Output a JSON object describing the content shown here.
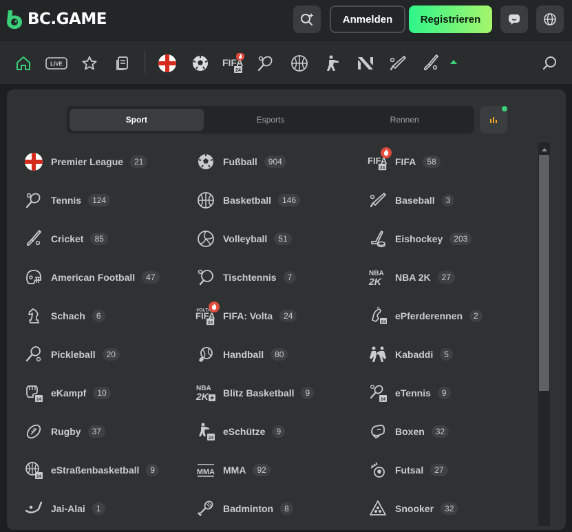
{
  "header": {
    "logo_text": "BC.GAME",
    "login_label": "Anmelden",
    "register_label": "Registrieren"
  },
  "nav": {
    "live_label": "LIVE",
    "fifa_label": "FIFA"
  },
  "tabs": [
    {
      "label": "Sport",
      "active": true
    },
    {
      "label": "Esports",
      "active": false
    },
    {
      "label": "Rennen",
      "active": false
    }
  ],
  "sports": [
    {
      "label": "Premier League",
      "count": "21",
      "icon": "england-flag-icon"
    },
    {
      "label": "Fußball",
      "count": "904",
      "icon": "soccer-ball-icon"
    },
    {
      "label": "FIFA",
      "count": "58",
      "icon": "fifa-icon",
      "hot": true
    },
    {
      "label": "Tennis",
      "count": "124",
      "icon": "tennis-icon"
    },
    {
      "label": "Basketball",
      "count": "146",
      "icon": "basketball-icon"
    },
    {
      "label": "Baseball",
      "count": "3",
      "icon": "baseball-icon"
    },
    {
      "label": "Cricket",
      "count": "85",
      "icon": "cricket-icon"
    },
    {
      "label": "Volleyball",
      "count": "51",
      "icon": "volleyball-icon"
    },
    {
      "label": "Eishockey",
      "count": "203",
      "icon": "ice-hockey-icon"
    },
    {
      "label": "American Football",
      "count": "47",
      "icon": "american-football-icon"
    },
    {
      "label": "Tischtennis",
      "count": "7",
      "icon": "table-tennis-icon"
    },
    {
      "label": "NBA 2K",
      "count": "27",
      "icon": "nba2k-icon"
    },
    {
      "label": "Schach",
      "count": "6",
      "icon": "chess-icon"
    },
    {
      "label": "FIFA: Volta",
      "count": "24",
      "icon": "fifa-volta-icon",
      "hot": true
    },
    {
      "label": "ePferderennen",
      "count": "2",
      "icon": "horse-racing-icon"
    },
    {
      "label": "Pickleball",
      "count": "20",
      "icon": "pickleball-icon"
    },
    {
      "label": "Handball",
      "count": "80",
      "icon": "handball-icon"
    },
    {
      "label": "Kabaddi",
      "count": "5",
      "icon": "kabaddi-icon"
    },
    {
      "label": "eKampf",
      "count": "10",
      "icon": "efight-icon"
    },
    {
      "label": "Blitz Basketball",
      "count": "9",
      "icon": "blitz-basketball-icon"
    },
    {
      "label": "eTennis",
      "count": "9",
      "icon": "etennis-icon"
    },
    {
      "label": "Rugby",
      "count": "37",
      "icon": "rugby-icon"
    },
    {
      "label": "eSchütze",
      "count": "9",
      "icon": "eshooter-icon"
    },
    {
      "label": "Boxen",
      "count": "32",
      "icon": "boxing-icon"
    },
    {
      "label": "eStraßenbasketball",
      "count": "9",
      "icon": "street-basketball-icon"
    },
    {
      "label": "MMA",
      "count": "92",
      "icon": "mma-icon"
    },
    {
      "label": "Futsal",
      "count": "27",
      "icon": "futsal-icon"
    },
    {
      "label": "Jai-Alai",
      "count": "1",
      "icon": "jai-alai-icon"
    },
    {
      "label": "Badminton",
      "count": "8",
      "icon": "badminton-icon"
    },
    {
      "label": "Snooker",
      "count": "32",
      "icon": "snooker-icon"
    }
  ],
  "colors": {
    "accent": "#3bd17a",
    "hot": "#e24a3b",
    "panel": "#2f3233"
  }
}
